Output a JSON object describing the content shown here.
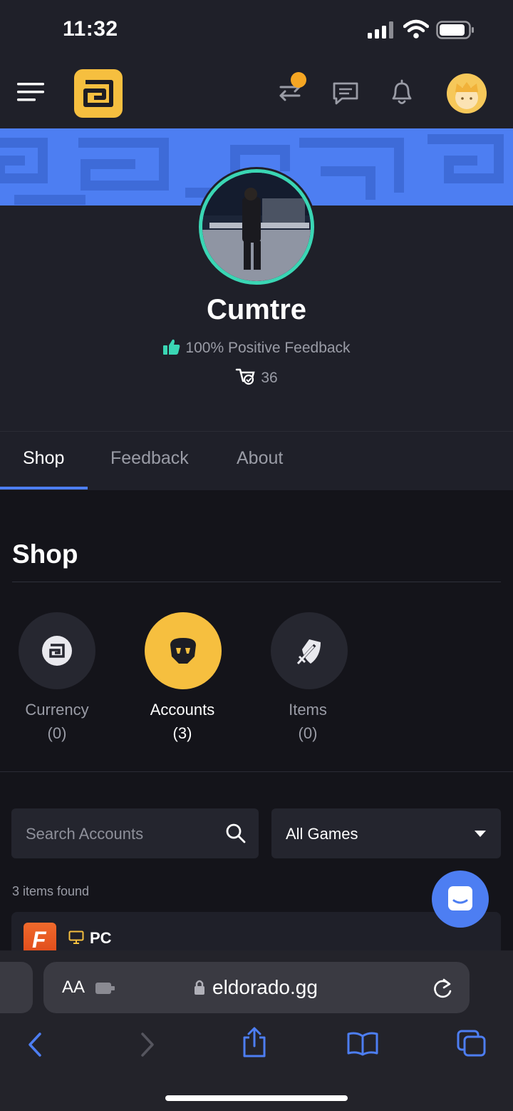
{
  "status_bar": {
    "time": "11:32"
  },
  "profile": {
    "username": "Cumtre",
    "feedback": "100% Positive Feedback",
    "orders": "36"
  },
  "tabs": [
    {
      "label": "Shop",
      "active": true
    },
    {
      "label": "Feedback",
      "active": false
    },
    {
      "label": "About",
      "active": false
    }
  ],
  "shop": {
    "title": "Shop",
    "categories": [
      {
        "label": "Currency",
        "count": "(0)",
        "icon": "currency-icon",
        "active": false
      },
      {
        "label": "Accounts",
        "count": "(3)",
        "icon": "helmet-icon",
        "active": true
      },
      {
        "label": "Items",
        "count": "(0)",
        "icon": "sword-shield-icon",
        "active": false
      }
    ],
    "search_placeholder": "Search Accounts",
    "games_select": "All Games",
    "items_found": "3 items found",
    "first_item": {
      "platform": "PC",
      "game_initial": "F"
    }
  },
  "browser": {
    "aa_label": "AA",
    "url": "eldorado.gg"
  },
  "colors": {
    "accent_blue": "#4d7ef2",
    "brand_yellow": "#f6bf3f",
    "ring_teal": "#3ad6b4",
    "notification_orange": "#f5a623"
  }
}
